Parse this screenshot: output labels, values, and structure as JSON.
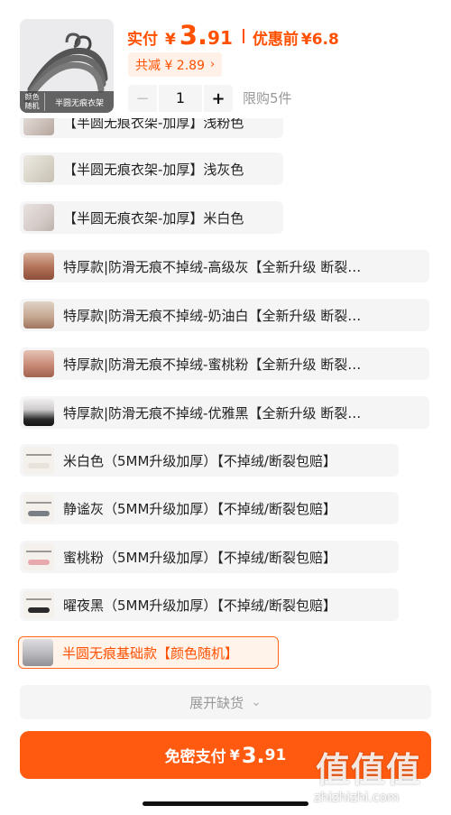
{
  "product": {
    "thumb_tag_left": "颜色\n随机",
    "thumb_tag_right": "半圆无痕衣架"
  },
  "price": {
    "label": "实付",
    "currency": "¥",
    "integer": "3.",
    "decimal": "91",
    "original_label": "优惠前",
    "original_value": "¥6.8"
  },
  "discount": {
    "text": "共减 ¥ 2.89",
    "chevron": "›"
  },
  "quantity": {
    "minus": "−",
    "value": "1",
    "plus": "+",
    "limit_text": "限购5件"
  },
  "options": [
    {
      "label": "【半圆无痕衣架-加厚】浅粉色",
      "icon": "hanger-box-pink-icon",
      "selected": false
    },
    {
      "label": "【半圆无痕衣架-加厚】浅灰色",
      "icon": "hanger-box-gray-icon",
      "selected": false
    },
    {
      "label": "【半圆无痕衣架-加厚】米白色",
      "icon": "hanger-box-white-icon",
      "selected": false
    },
    {
      "label": "特厚款|防滑无痕不掉绒-高级灰【全新升级 断裂…",
      "icon": "hanger-gray-icon",
      "selected": false
    },
    {
      "label": "特厚款|防滑无痕不掉绒-奶油白【全新升级 断裂…",
      "icon": "hanger-cream-icon",
      "selected": false
    },
    {
      "label": "特厚款|防滑无痕不掉绒-蜜桃粉【全新升级 断裂…",
      "icon": "hanger-peach-icon",
      "selected": false
    },
    {
      "label": "特厚款|防滑无痕不掉绒-优雅黑【全新升级 断裂…",
      "icon": "hanger-black-icon",
      "selected": false
    },
    {
      "label": "米白色（5MM升级加厚）【不掉绒/断裂包赔】",
      "icon": "hanger-rack-white-icon",
      "selected": false
    },
    {
      "label": "静谧灰（5MM升级加厚）【不掉绒/断裂包赔】",
      "icon": "hanger-rack-gray-icon",
      "selected": false
    },
    {
      "label": "蜜桃粉（5MM升级加厚）【不掉绒/断裂包赔】",
      "icon": "hanger-rack-pink-icon",
      "selected": false
    },
    {
      "label": "曜夜黑（5MM升级加厚）【不掉绒/断裂包赔】",
      "icon": "hanger-rack-black-icon",
      "selected": false
    },
    {
      "label": "半圆无痕基础款【颜色随机】",
      "icon": "hanger-basic-icon",
      "selected": true
    }
  ],
  "expand": {
    "label": "展开缺货",
    "chevron": "⌄"
  },
  "pay": {
    "label": "免密支付",
    "currency": "¥",
    "integer": "3.",
    "decimal": "91"
  },
  "watermark": {
    "logo": "值值值",
    "url": "zhizhizhi.com"
  },
  "colors": {
    "accent": "#ff5000",
    "pay_button": "#ff5a0f",
    "selected_bg": "#fff3ea",
    "option_bg": "#f5f5f5"
  }
}
